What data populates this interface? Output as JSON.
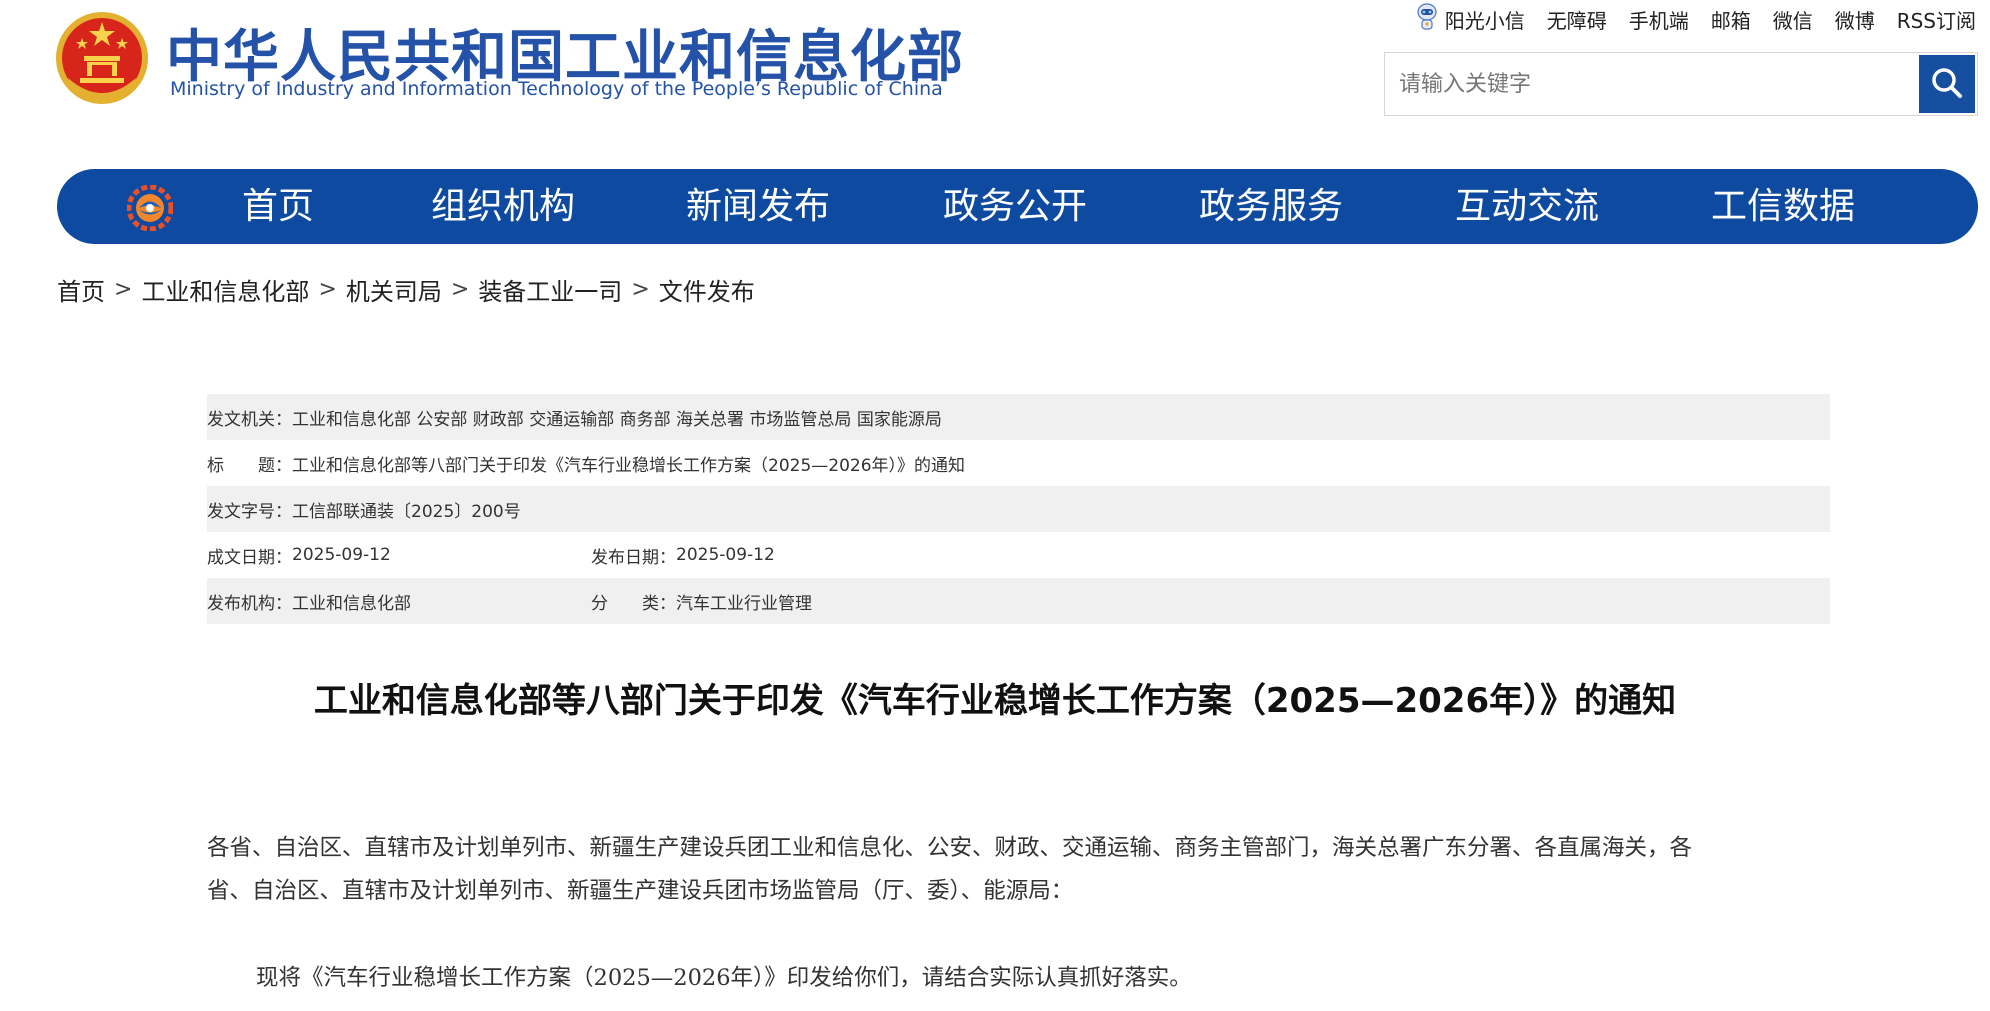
{
  "header": {
    "title": "中华人民共和国工业和信息化部",
    "subtitle": "Ministry of Industry and Information Technology of the People’s Republic of China",
    "top_links": [
      "阳光小信",
      "无障碍",
      "手机端",
      "邮箱",
      "微信",
      "微博",
      "RSS订阅"
    ],
    "search": {
      "placeholder": "请输入关键字"
    }
  },
  "nav": {
    "items": [
      "首页",
      "组织机构",
      "新闻发布",
      "政务公开",
      "政务服务",
      "互动交流",
      "工信数据"
    ]
  },
  "breadcrumb": [
    "首页",
    "工业和信息化部",
    "机关司局",
    "装备工业一司",
    "文件发布"
  ],
  "meta": {
    "issuer_label": "发文机关：",
    "issuer_value": "工业和信息化部 公安部 财政部 交通运输部 商务部 海关总署 市场监管总局 国家能源局",
    "title_label": "标　　题：",
    "title_value": "工业和信息化部等八部门关于印发《汽车行业稳增长工作方案（2025—2026年）》的通知",
    "doc_no_label": "发文字号：",
    "doc_no_value": "工信部联通装〔2025〕200号",
    "created_label": "成文日期：",
    "created_value": "2025-09-12",
    "published_label": "发布日期：",
    "published_value": "2025-09-12",
    "org_label": "发布机构：",
    "org_value": "工业和信息化部",
    "category_label": "分　　类：",
    "category_value": "汽车工业行业管理"
  },
  "article": {
    "title": "工业和信息化部等八部门关于印发《汽车行业稳增长工作方案（2025—2026年）》的通知",
    "addressee_line1": "各省、自治区、直辖市及计划单列市、新疆生产建设兵团工业和信息化、公安、财政、交通运输、商务主管部门，海关总署广东分署、各直属海关，各",
    "addressee_line2": "省、自治区、直辖市及计划单列市、新疆生产建设兵团市场监管局（厅、委）、能源局：",
    "body_line1": "现将《汽车行业稳增长工作方案（2025—2026年）》印发给你们，请结合实际认真抓好落实。"
  },
  "colors": {
    "brand_blue": "#2352a8",
    "nav_blue": "#0e4ba0",
    "search_button": "#164fa0",
    "meta_shade": "#f0f0f0"
  },
  "icons": {
    "emblem": "national-emblem-icon",
    "robot": "robot-icon",
    "search": "search-icon",
    "nav_logo": "miit-logo-icon"
  }
}
